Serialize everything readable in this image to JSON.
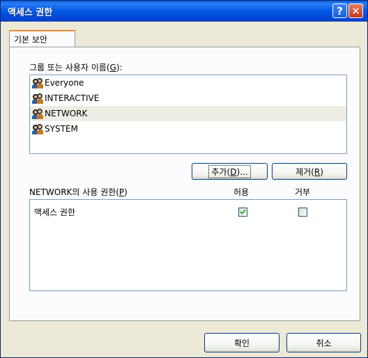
{
  "window": {
    "title": "액세스 권한",
    "help_glyph": "?",
    "close_glyph": "✕"
  },
  "tabs": [
    {
      "label": "기본 보안"
    }
  ],
  "group_label": {
    "prefix": "그룹 또는 사용자 이름(",
    "key": "G",
    "suffix": "):"
  },
  "users": [
    {
      "name": "Everyone",
      "icon": "user-group-icon"
    },
    {
      "name": "INTERACTIVE",
      "icon": "user-group-icon"
    },
    {
      "name": "NETWORK",
      "icon": "user-group-icon",
      "selected": true
    },
    {
      "name": "SYSTEM",
      "icon": "user-group-icon"
    }
  ],
  "buttons": {
    "add": {
      "prefix": "추가(",
      "key": "D",
      "suffix": ")..."
    },
    "remove": {
      "prefix": "제거(",
      "key": "R",
      "suffix": ")"
    },
    "ok": "확인",
    "cancel": "취소"
  },
  "permissions": {
    "label_prefix": "NETWORK의 사용 권한(",
    "label_key": "P",
    "label_suffix": ")",
    "allow_header": "허용",
    "deny_header": "거부",
    "rows": [
      {
        "name": "액세스 권한",
        "allow": true,
        "deny": false
      }
    ]
  }
}
